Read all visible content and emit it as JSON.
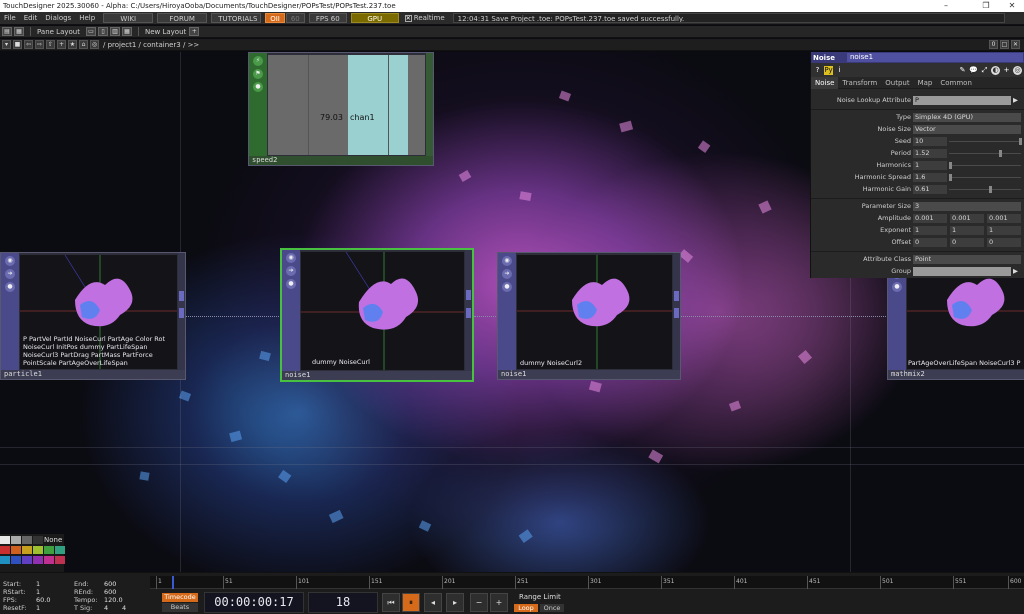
{
  "window": {
    "title": "TouchDesigner 2025.30060 - Alpha: C:/Users/HiroyaOoba/Documents/TouchDesigner/POPsTest/POPsTest.237.toe",
    "minimize": "–",
    "maximize": "❐",
    "close": "✕"
  },
  "menubar": {
    "items": [
      "File",
      "Edit",
      "Dialogs",
      "Help"
    ],
    "wiki": "WIKI",
    "forum": "FORUM",
    "tutorials": "TUTORIALS",
    "oil": "OII",
    "sixty": "60",
    "fps_label": "FPS 60",
    "gpu": "GPU",
    "realtime_check": "✕",
    "realtime": "Realtime",
    "status": "12:04:31 Save Project .toe: POPsTest.237.toe saved successfully."
  },
  "toolbar": {
    "pane_layout": "Pane Layout",
    "new_layout": "New Layout",
    "plus": "+"
  },
  "pathbar": {
    "path": "/ project1 / container3 / >>",
    "right_zero": "0"
  },
  "operators": {
    "speed2": {
      "name": "speed2",
      "value": "79.03",
      "channel": "chan1"
    },
    "particle1": {
      "name": "particle1",
      "overlay": [
        "P PartVel PartId NoiseCurl PartAge Color Rot",
        "NoiseCurl InitPos dummy PartLifeSpan",
        "NoiseCurl3 PartDrag PartMass PartForce",
        "PointScale PartAgeOverLifeSpan"
      ]
    },
    "noise1": {
      "name": "noise1",
      "overlay": "dummy NoiseCurl"
    },
    "noise1b": {
      "name": "noise1",
      "overlay": "dummy NoiseCurl2"
    },
    "mathmix2": {
      "name": "mathmix2",
      "overlay": "PartAgeOverLifeSpan NoiseCurl3 P"
    }
  },
  "params": {
    "op_type": "Noise",
    "op_name": "noise1",
    "help_icon": "?",
    "python_icon": "🐍",
    "info_icon": "i",
    "tabs": [
      "Noise",
      "Transform",
      "Output",
      "Map",
      "Common"
    ],
    "noise_lookup": {
      "label": "Noise Lookup Attribute",
      "value": "P"
    },
    "type": {
      "label": "Type",
      "value": "Simplex 4D (GPU)"
    },
    "noise_size": {
      "label": "Noise Size",
      "value": "Vector"
    },
    "seed": {
      "label": "Seed",
      "value": "10"
    },
    "period": {
      "label": "Period",
      "value": "1.52"
    },
    "harmonics": {
      "label": "Harmonics",
      "value": "1"
    },
    "harmonic_spread": {
      "label": "Harmonic Spread",
      "value": "1.6"
    },
    "harmonic_gain": {
      "label": "Harmonic Gain",
      "value": "0.61"
    },
    "parameter_size": {
      "label": "Parameter Size",
      "value": "3"
    },
    "amplitude": {
      "label": "Amplitude",
      "v1": "0.001",
      "v2": "0.001",
      "v3": "0.001"
    },
    "exponent": {
      "label": "Exponent",
      "v1": "1",
      "v2": "1",
      "v3": "1"
    },
    "offset": {
      "label": "Offset",
      "v1": "0",
      "v2": "0",
      "v3": "0"
    },
    "attribute_class": {
      "label": "Attribute Class",
      "value": "Point"
    },
    "group": {
      "label": "Group",
      "value": ""
    }
  },
  "swatches": {
    "none": "None"
  },
  "timeline": {
    "start_label": "Start:",
    "start": "1",
    "rstart_label": "RStart:",
    "rstart": "1",
    "fps_label": "FPS:",
    "fps": "60.0",
    "resetf_label": "ResetF:",
    "resetf": "1",
    "end_label": "End:",
    "end": "600",
    "rend_label": "REnd:",
    "rend": "600",
    "tempo_label": "Tempo:",
    "tempo": "120.0",
    "tsig_label": "T Sig:",
    "tsig1": "4",
    "tsig2": "4",
    "ruler_labels": [
      "1",
      "51",
      "101",
      "151",
      "201",
      "251",
      "301",
      "351",
      "401",
      "451",
      "501",
      "551",
      "600"
    ],
    "timecode_btn": "Timecode",
    "beats_btn": "Beats",
    "timecode": "00:00:00:17",
    "frame": "18",
    "rewind": "⏮",
    "pause": "⏸",
    "step_back": "◂",
    "play": "▸",
    "minus": "−",
    "plus": "+",
    "range_limit": "Range Limit",
    "loop": "Loop",
    "once": "Once"
  }
}
